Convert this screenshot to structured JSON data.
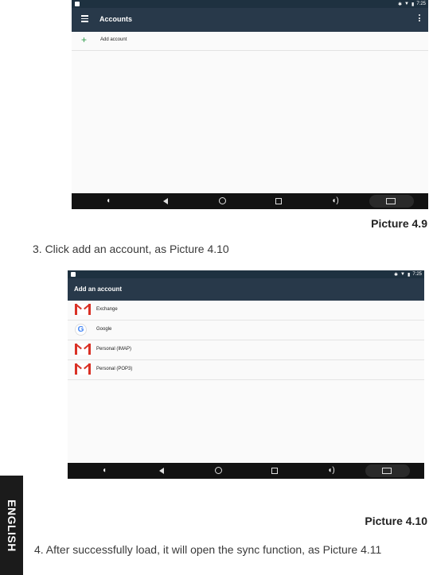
{
  "picture_4_9": {
    "status": {
      "time": "7:25",
      "icons": [
        "bluetooth-icon",
        "wifi-icon",
        "battery-icon"
      ]
    },
    "appbar": {
      "title": "Accounts"
    },
    "list": {
      "add_account_label": "Add account",
      "add_icon": "plus-icon"
    },
    "navbar": [
      "volume-down-icon",
      "back-icon",
      "home-icon",
      "recents-icon",
      "volume-up-icon",
      "screenshot-icon"
    ]
  },
  "caption_4_9": "Picture 4.9",
  "step_3": "3. Click add an account, as Picture 4.10",
  "picture_4_10": {
    "status": {
      "time": "7:25"
    },
    "appbar": {
      "title": "Add an account"
    },
    "accounts": [
      {
        "label": "Exchange",
        "icon": "gmail-icon"
      },
      {
        "label": "Google",
        "icon": "google-icon"
      },
      {
        "label": "Personal (IMAP)",
        "icon": "gmail-icon"
      },
      {
        "label": "Personal (POP3)",
        "icon": "gmail-icon"
      }
    ]
  },
  "caption_4_10": "Picture 4.10",
  "step_4": "4. After successfully load, it will open the sync function, as Picture 4.11",
  "side_tab": "ENGLISH",
  "colors": {
    "appbar": "#28394a",
    "statusbar": "#1e3140",
    "navbar": "#121212",
    "plus": "#2f9a4a",
    "gmail_red": "#d93025"
  }
}
